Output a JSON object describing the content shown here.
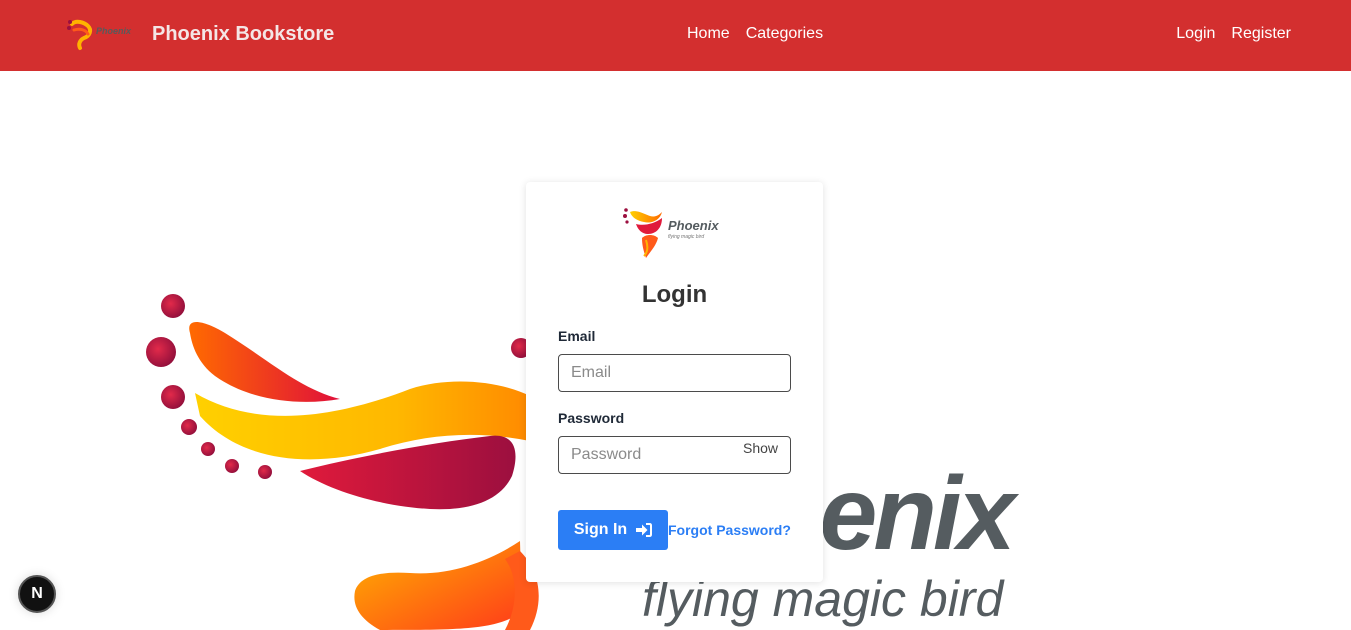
{
  "navbar": {
    "brand_name": "Phoenix Bookstore",
    "logo_text": "Phoenix",
    "center_links": [
      {
        "label": "Home"
      },
      {
        "label": "Categories"
      }
    ],
    "right_links": [
      {
        "label": "Login"
      },
      {
        "label": "Register"
      }
    ],
    "bg_color": "#d32f2f"
  },
  "background": {
    "wordmark": "oenix",
    "tagline": "flying magic bird"
  },
  "card": {
    "logo_text": "Phoenix",
    "logo_subtext": "flying magic bird",
    "title": "Login",
    "email_label": "Email",
    "email_placeholder": "Email",
    "password_label": "Password",
    "password_placeholder": "Password",
    "show_label": "Show",
    "signin_label": "Sign In",
    "forgot_label": "Forgot Password?"
  },
  "badge": {
    "label": "N"
  },
  "colors": {
    "accent": "#2b7ef5",
    "brand": "#d32f2f",
    "wordmark": "#555c60"
  }
}
